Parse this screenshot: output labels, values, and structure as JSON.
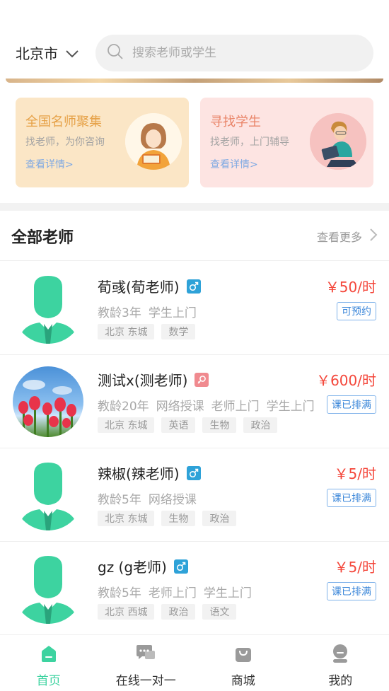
{
  "header": {
    "city": "北京市",
    "search_placeholder": "搜索老师或学生"
  },
  "promo_cards": [
    {
      "title": "全国名师聚集",
      "subtitle": "找老师，为你咨询",
      "link": "查看详情>"
    },
    {
      "title": "寻找学生",
      "subtitle": "找老师，上门辅导",
      "link": "查看详情>"
    }
  ],
  "section": {
    "title": "全部老师",
    "more": "查看更多"
  },
  "teachers": [
    {
      "name": "荀彧(荀老师)",
      "gender": "male",
      "meta": [
        "教龄3年",
        "学生上门"
      ],
      "tags": [
        "北京 东城",
        "数学"
      ],
      "price": "￥50/时",
      "status": "可预约",
      "avatar": "default"
    },
    {
      "name": "测试x(测老师)",
      "gender": "female",
      "meta": [
        "教龄20年",
        "网络授课",
        "老师上门",
        "学生上门"
      ],
      "tags": [
        "北京 东城",
        "英语",
        "生物",
        "政治"
      ],
      "price": "￥600/时",
      "status": "课已排满",
      "avatar": "photo"
    },
    {
      "name": "辣椒(辣老师)",
      "gender": "male",
      "meta": [
        "教龄5年",
        "网络授课"
      ],
      "tags": [
        "北京 东城",
        "生物",
        "政治"
      ],
      "price": "￥5/时",
      "status": "课已排满",
      "avatar": "default"
    },
    {
      "name": "gz (g老师)",
      "gender": "male",
      "meta": [
        "教龄5年",
        "老师上门",
        "学生上门"
      ],
      "tags": [
        "北京 西城",
        "政治",
        "语文"
      ],
      "price": "￥5/时",
      "status": "课已排满",
      "avatar": "default"
    }
  ],
  "bottom_nav": [
    {
      "label": "首页",
      "icon": "home-icon",
      "active": true
    },
    {
      "label": "在线一对一",
      "icon": "chat-icon",
      "active": false
    },
    {
      "label": "商城",
      "icon": "shop-bag-icon",
      "active": false
    },
    {
      "label": "我的",
      "icon": "profile-icon",
      "active": false
    }
  ],
  "colors": {
    "accent": "#3dd3a0",
    "price": "#f4473b",
    "status_border": "#7fb2ea",
    "male": "#2ea2d8",
    "female": "#f08a8f"
  }
}
